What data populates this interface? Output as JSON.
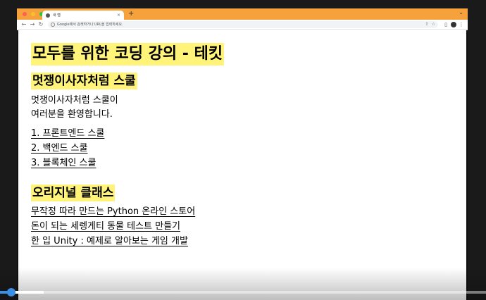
{
  "browser": {
    "tab_title": "새 탭",
    "tab_close": "×",
    "new_tab": "+",
    "tabstrip_menu": "⌄",
    "address_text": "Google에서 검색하거나 URL을 입력하세요.",
    "colors": {
      "tabstrip": "#f6a23c",
      "dot_close": "#ff5f57",
      "dot_min": "#febc2e",
      "dot_max": "#28c840"
    }
  },
  "page": {
    "title": "모두를 위한 코딩 강의 - 테킷",
    "section1": {
      "heading": "멋쟁이사자처럼 스쿨",
      "intro_line1": "멋쟁이사자처럼 스쿨이",
      "intro_line2": "여러분을 환영합니다.",
      "links": [
        "1. 프론트엔드 스쿨",
        "2. 백엔드 스쿨",
        "3. 블록체인 스쿨"
      ]
    },
    "section2": {
      "heading": "오리지널 클래스",
      "links": [
        "무작정 따라 만드는 Python 온라인 스토어",
        "돈이 되는 세렝게티 동물 테스트 만들기",
        "한 입 Unity : 예제로 알아보는 게임 개발"
      ]
    }
  },
  "player": {
    "progress": 0.03,
    "buffered": 0.09
  }
}
